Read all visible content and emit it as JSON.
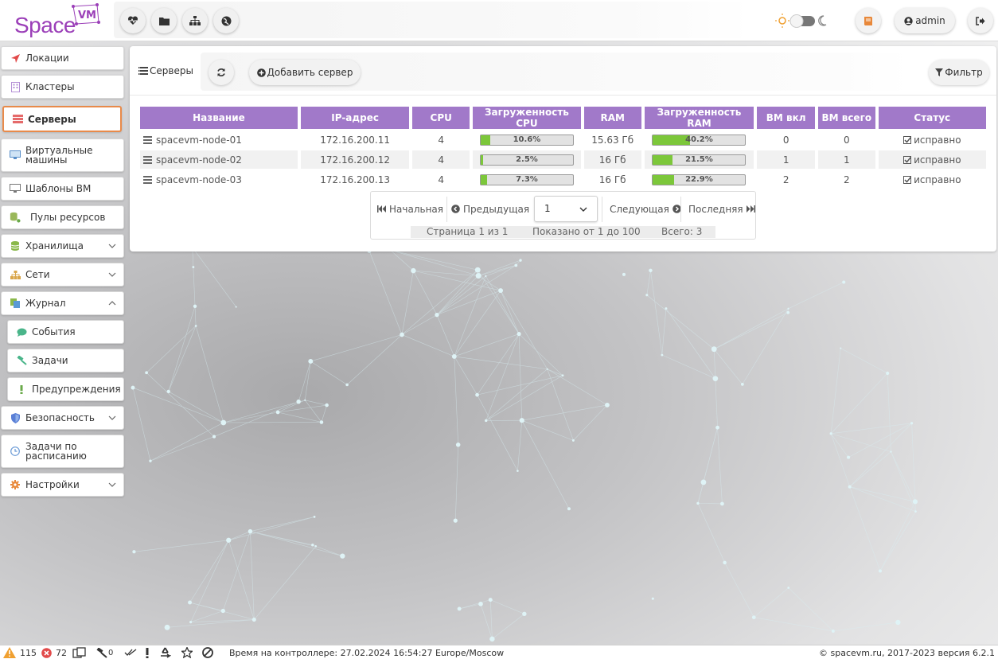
{
  "app": {
    "logo_text": "Space",
    "logo_badge": "VM"
  },
  "topbar": {
    "icons": [
      "heart-pulse-icon",
      "folder-icon",
      "sitemap-icon",
      "globe-icon"
    ],
    "user_label": "admin"
  },
  "sidebar": {
    "items": [
      {
        "label": "Локации"
      },
      {
        "label": "Кластеры"
      },
      {
        "label": "Серверы"
      },
      {
        "label": "Виртуальные машины"
      },
      {
        "label": "Шаблоны ВМ"
      },
      {
        "label": "Пулы ресурсов"
      },
      {
        "label": "Хранилища"
      },
      {
        "label": "Сети"
      },
      {
        "label": "Журнал"
      },
      {
        "label": "События"
      },
      {
        "label": "Задачи"
      },
      {
        "label": "Предупреждения"
      },
      {
        "label": "Безопасность"
      },
      {
        "label": "Задачи по расписанию"
      },
      {
        "label": "Настройки"
      }
    ]
  },
  "main": {
    "title": "Серверы",
    "add_label": "Добавить сервер",
    "filter_label": "Фильтр"
  },
  "table": {
    "columns": [
      "Название",
      "IP-адрес",
      "CPU",
      "Загруженность CPU",
      "RAM",
      "Загруженность RAM",
      "ВМ вкл",
      "ВМ всего",
      "Статус"
    ],
    "rows": [
      {
        "name": "spacevm-node-01",
        "ip": "172.16.200.11",
        "cpu": "4",
        "cpu_load": "10.6%",
        "cpu_pct": 10.6,
        "ram": "15.63 Гб",
        "ram_load": "40.2%",
        "ram_pct": 40.2,
        "vm_on": "0",
        "vm_total": "0",
        "status": "исправно"
      },
      {
        "name": "spacevm-node-02",
        "ip": "172.16.200.12",
        "cpu": "4",
        "cpu_load": "2.5%",
        "cpu_pct": 2.5,
        "ram": "16 Гб",
        "ram_load": "21.5%",
        "ram_pct": 21.5,
        "vm_on": "1",
        "vm_total": "1",
        "status": "исправно"
      },
      {
        "name": "spacevm-node-03",
        "ip": "172.16.200.13",
        "cpu": "4",
        "cpu_load": "7.3%",
        "cpu_pct": 7.3,
        "ram": "16 Гб",
        "ram_load": "22.9%",
        "ram_pct": 22.9,
        "vm_on": "2",
        "vm_total": "2",
        "status": "исправно"
      }
    ]
  },
  "pager": {
    "first": "Начальная",
    "prev": "Предыдущая",
    "page_value": "1",
    "next": "Следующая",
    "last": "Последняя",
    "page_info": "Страница 1 из 1",
    "shown_info": "Показано от 1 до 100",
    "total_info": "Всего: 3"
  },
  "footer": {
    "warnings_count": "115",
    "errors_count": "72",
    "tasks_count": "0",
    "controller_time": "Время на контроллере: 27.02.2024 16:54:27 Europe/Moscow",
    "copyright": "© spacevm.ru, 2017-2023 версия 6.2.1"
  },
  "colors": {
    "accent": "#a179c9",
    "brand": "#9b3fb8",
    "active_border": "#e88a4a",
    "progress": "#7cc73a"
  }
}
